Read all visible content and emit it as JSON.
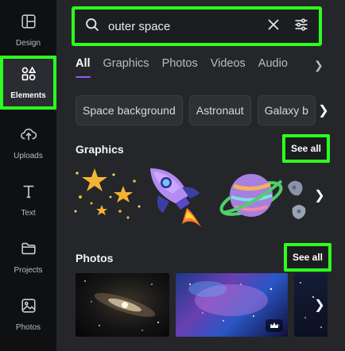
{
  "rail": {
    "items": [
      {
        "label": "Design",
        "icon": "design-icon"
      },
      {
        "label": "Elements",
        "icon": "elements-icon"
      },
      {
        "label": "Uploads",
        "icon": "upload-cloud-icon"
      },
      {
        "label": "Text",
        "icon": "text-icon"
      },
      {
        "label": "Projects",
        "icon": "folder-icon"
      },
      {
        "label": "Photos",
        "icon": "photo-icon"
      }
    ]
  },
  "search": {
    "query": "outer space"
  },
  "tabs": [
    "All",
    "Graphics",
    "Photos",
    "Videos",
    "Audio"
  ],
  "chips": [
    "Space background",
    "Astronaut",
    "Galaxy b"
  ],
  "graphics": {
    "title": "Graphics",
    "see_all": "See all"
  },
  "photos": {
    "title": "Photos",
    "see_all": "See all"
  },
  "colors": {
    "highlight": "#2dff1f",
    "accent": "#8b5cf6"
  }
}
